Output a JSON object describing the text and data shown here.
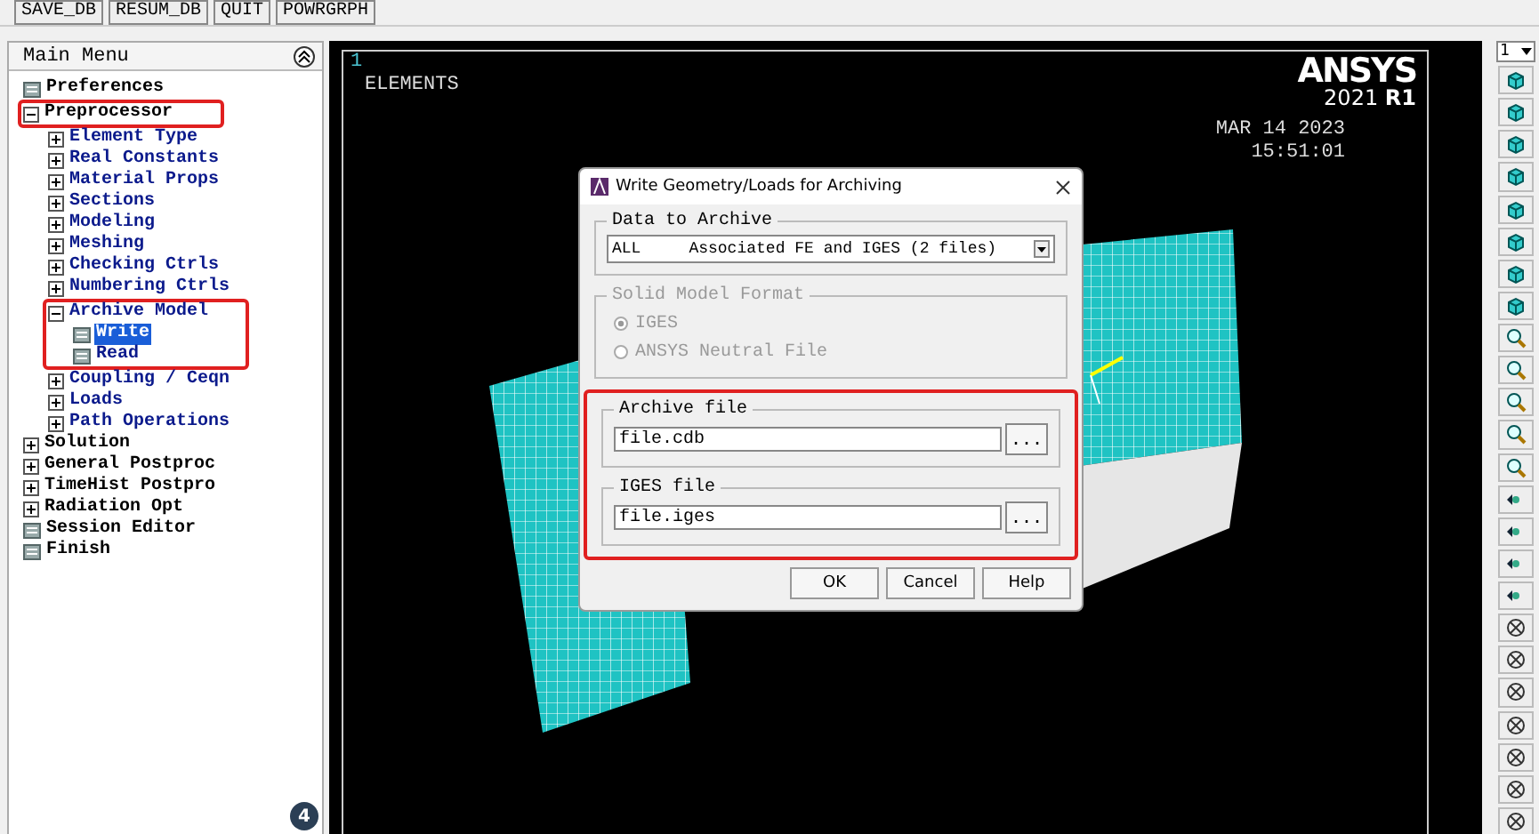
{
  "toolbar": {
    "buttons": [
      "SAVE_DB",
      "RESUM_DB",
      "QUIT",
      "POWRGRPH"
    ]
  },
  "main_menu": {
    "title": "Main Menu",
    "items": [
      {
        "label": "Preferences",
        "kind": "leaf",
        "selected": false
      },
      {
        "label": "Preprocessor",
        "kind": "folder",
        "expanded": true,
        "selected": false,
        "children": [
          {
            "label": "Element Type",
            "kind": "folder",
            "expanded": false,
            "selected": false
          },
          {
            "label": "Real Constants",
            "kind": "folder",
            "expanded": false,
            "selected": false
          },
          {
            "label": "Material Props",
            "kind": "folder",
            "expanded": false,
            "selected": false
          },
          {
            "label": "Sections",
            "kind": "folder",
            "expanded": false,
            "selected": false
          },
          {
            "label": "Modeling",
            "kind": "folder",
            "expanded": false,
            "selected": false
          },
          {
            "label": "Meshing",
            "kind": "folder",
            "expanded": false,
            "selected": false
          },
          {
            "label": "Checking Ctrls",
            "kind": "folder",
            "expanded": false,
            "selected": false
          },
          {
            "label": "Numbering Ctrls",
            "kind": "folder",
            "expanded": false,
            "selected": false
          },
          {
            "label": "Archive Model",
            "kind": "folder",
            "expanded": true,
            "selected": false,
            "children": [
              {
                "label": "Write",
                "kind": "leaf",
                "selected": true
              },
              {
                "label": "Read",
                "kind": "leaf",
                "selected": false
              }
            ]
          },
          {
            "label": "Coupling / Ceqn",
            "kind": "folder",
            "expanded": false,
            "selected": false
          },
          {
            "label": "Loads",
            "kind": "folder",
            "expanded": false,
            "selected": false
          },
          {
            "label": "Path Operations",
            "kind": "folder",
            "expanded": false,
            "selected": false
          }
        ]
      },
      {
        "label": "Solution",
        "kind": "folder",
        "expanded": false,
        "selected": false
      },
      {
        "label": "General Postproc",
        "kind": "folder",
        "expanded": false,
        "selected": false
      },
      {
        "label": "TimeHist Postpro",
        "kind": "folder",
        "expanded": false,
        "selected": false
      },
      {
        "label": "Radiation Opt",
        "kind": "folder",
        "expanded": false,
        "selected": false
      },
      {
        "label": "Session Editor",
        "kind": "leaf",
        "selected": false
      },
      {
        "label": "Finish",
        "kind": "leaf",
        "selected": false
      }
    ],
    "badge": "4"
  },
  "graphics": {
    "window_number": "1",
    "label": "ELEMENTS",
    "logo": "ANSYS",
    "version": "2021 **R1**",
    "date": "MAR 14 2023",
    "time": "15:51:01"
  },
  "dialog": {
    "title": "Write Geometry/Loads for Archiving",
    "data_to_archive": {
      "label": "Data to Archive",
      "value": "ALL     Associated FE and IGES (2 files)"
    },
    "solid_model_format": {
      "label": "Solid Model Format",
      "disabled": true,
      "options": [
        {
          "label": "IGES",
          "selected": true
        },
        {
          "label": "ANSYS Neutral File",
          "selected": false
        }
      ]
    },
    "archive_file": {
      "label": "Archive file",
      "value": "file.cdb",
      "browse": "..."
    },
    "iges_file": {
      "label": "IGES file",
      "value": "file.iges",
      "browse": "..."
    },
    "buttons": [
      "OK",
      "Cancel",
      "Help"
    ]
  },
  "right_toolbar": {
    "window_select": "1"
  }
}
